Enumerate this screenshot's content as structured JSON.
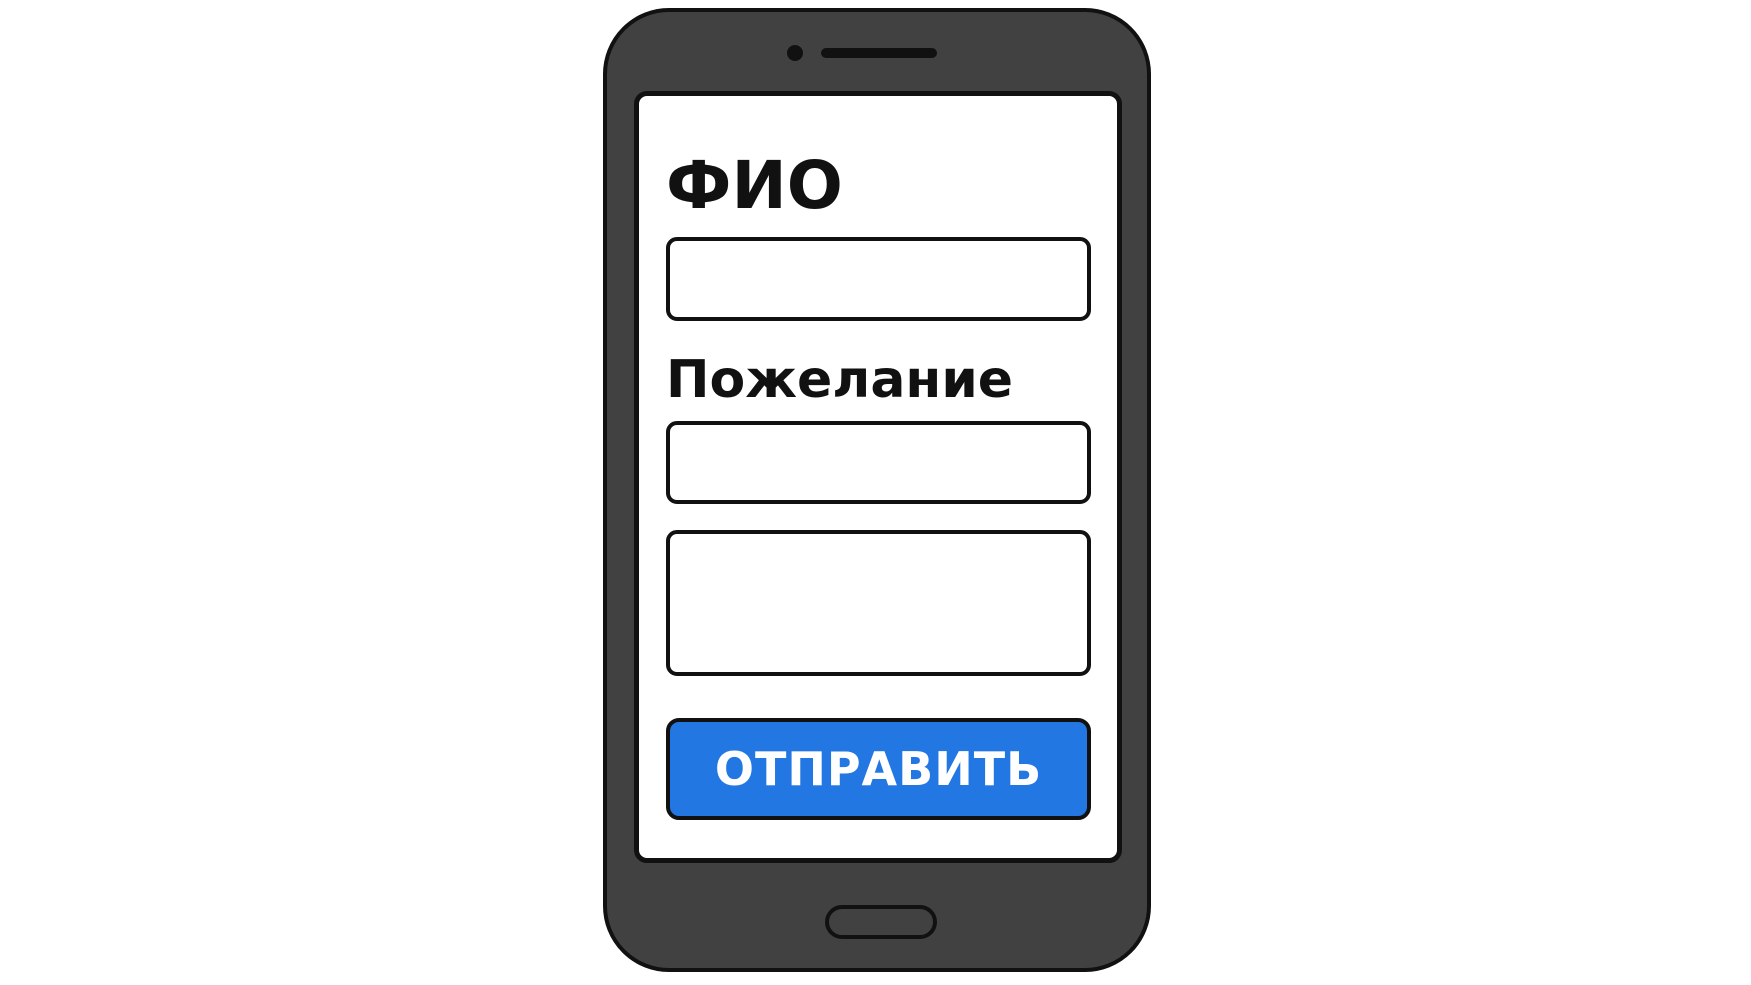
{
  "form": {
    "fio_label": "ФИО",
    "fio_value": "",
    "fio_placeholder": "",
    "wish_label": "Пожелание",
    "wish_value": "",
    "wish_placeholder": "",
    "extra_value": "",
    "extra_placeholder": "",
    "submit_label": "ОТПРАВИТЬ"
  },
  "colors": {
    "device_body": "#414141",
    "outline": "#111111",
    "screen_background": "#ffffff",
    "submit_button": "#2277e3",
    "submit_text": "#ffffff"
  },
  "icons": {
    "camera": "camera-icon",
    "speaker": "speaker-grille",
    "home": "home-button"
  }
}
